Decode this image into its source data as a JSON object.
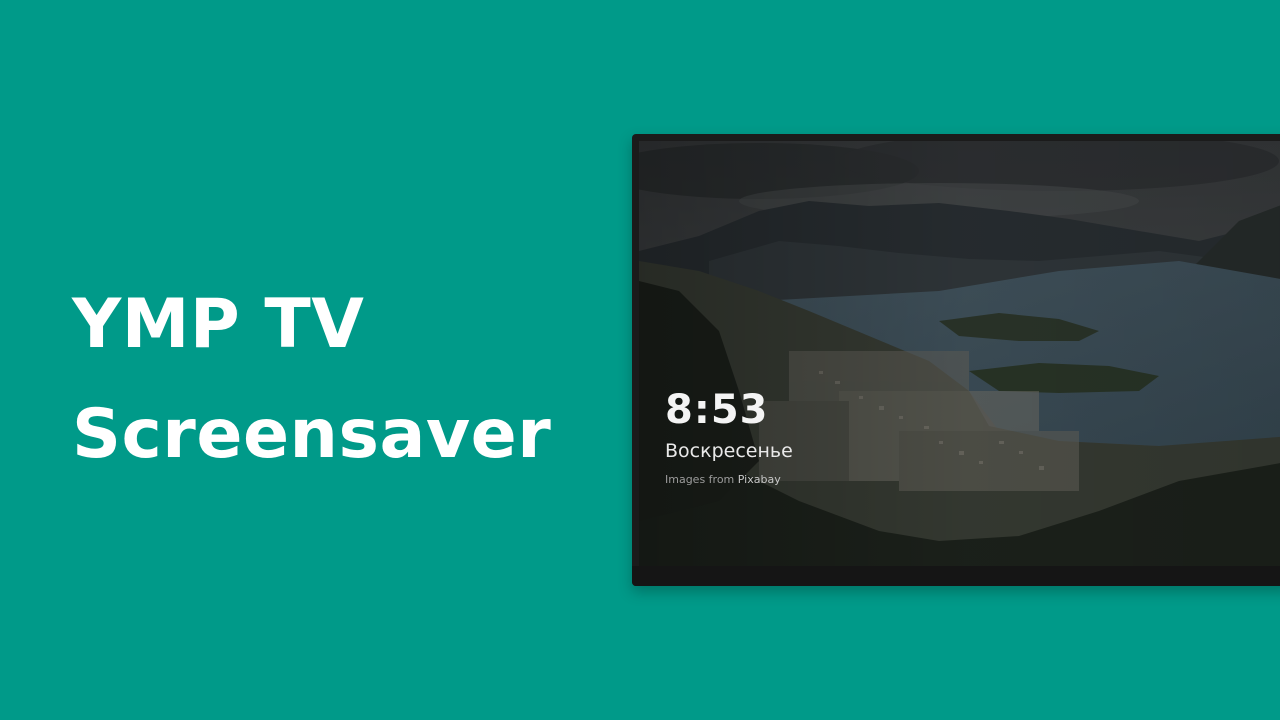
{
  "headline": {
    "line1": "YMP TV",
    "line2": "Screensaver"
  },
  "screensaver": {
    "time": "8:53",
    "day": "Воскресенье",
    "credit_prefix": "Images from",
    "credit_source": "Pixabay",
    "background_image": "landscape-photo-lake-mountains-town"
  },
  "colors": {
    "background": "#009a89",
    "tv_frame": "#1b1b1b",
    "headline_text": "#ffffff"
  }
}
